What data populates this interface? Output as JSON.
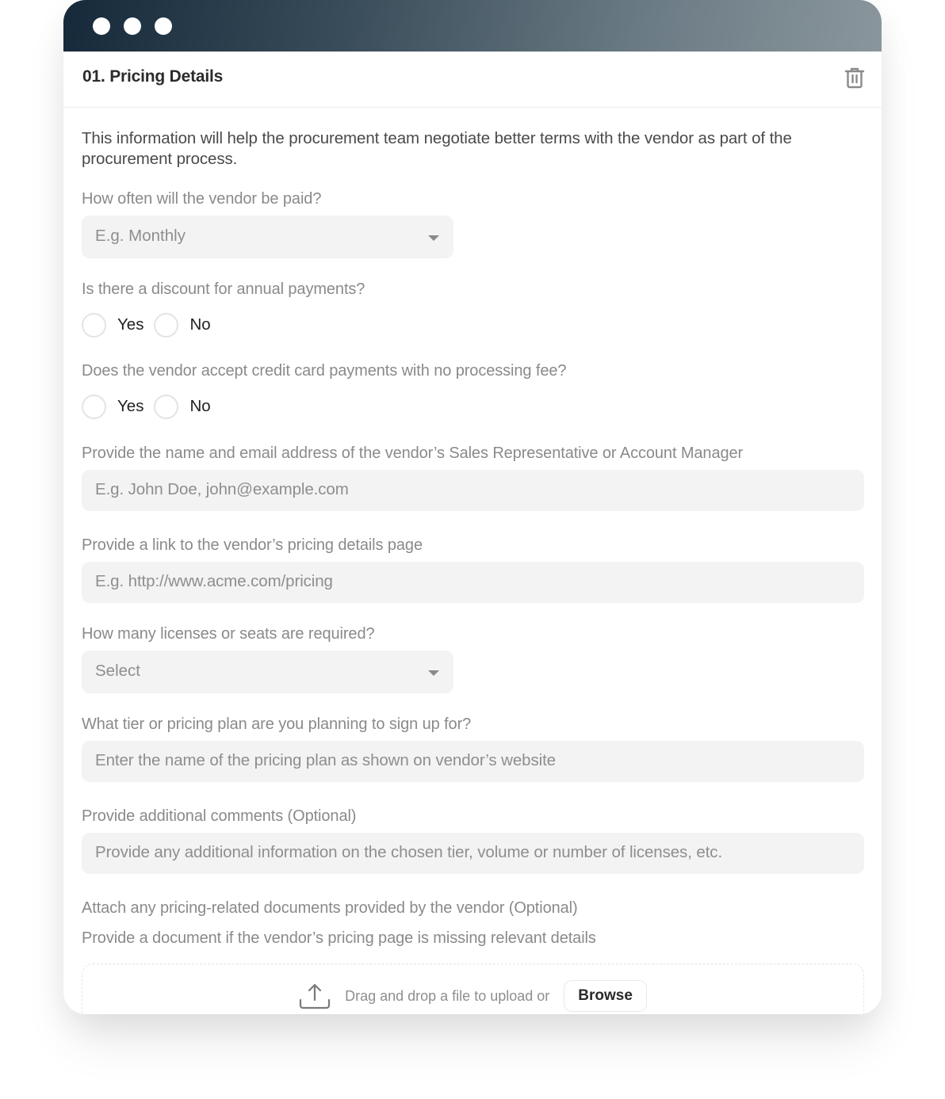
{
  "window": {
    "controls": [
      "close",
      "minimize",
      "zoom"
    ]
  },
  "section": {
    "title": "01. Pricing Details",
    "delete_icon": "trash-icon"
  },
  "form": {
    "description": "This information will help the procurement team negotiate better terms with the vendor as part of the procurement process.",
    "payment_frequency": {
      "label": "How often will the vendor be paid?",
      "placeholder": "E.g. Monthly"
    },
    "annual_discount": {
      "label": "Is there a discount for annual payments?",
      "options": [
        "Yes",
        "No"
      ]
    },
    "credit_card": {
      "label": "Does the vendor accept credit card payments with no processing fee?",
      "options": [
        "Yes",
        "No"
      ]
    },
    "sales_rep": {
      "label": "Provide the name and email address of the vendor’s Sales Representative or Account Manager",
      "placeholder": "E.g. John Doe, john@example.com"
    },
    "pricing_link": {
      "label": "Provide a link to the vendor’s pricing details page",
      "placeholder": "E.g. http://www.acme.com/pricing"
    },
    "licenses": {
      "label": "How many licenses or seats are required?",
      "placeholder": "Select"
    },
    "pricing_plan": {
      "label": "What tier or pricing plan are you planning to sign up for?",
      "placeholder": "Enter the name of the pricing plan as shown on vendor’s website"
    },
    "comments": {
      "label": "Provide additional comments (Optional)",
      "placeholder": "Provide any additional information on the chosen tier, volume or number of licenses, etc."
    },
    "attachments": {
      "label": "Attach any pricing-related documents provided by the vendor (Optional)",
      "hint": "Provide a document if the vendor’s pricing page is missing relevant details",
      "drop_text": "Drag and drop a file to upload or",
      "browse_label": "Browse",
      "icon": "upload-icon"
    }
  }
}
